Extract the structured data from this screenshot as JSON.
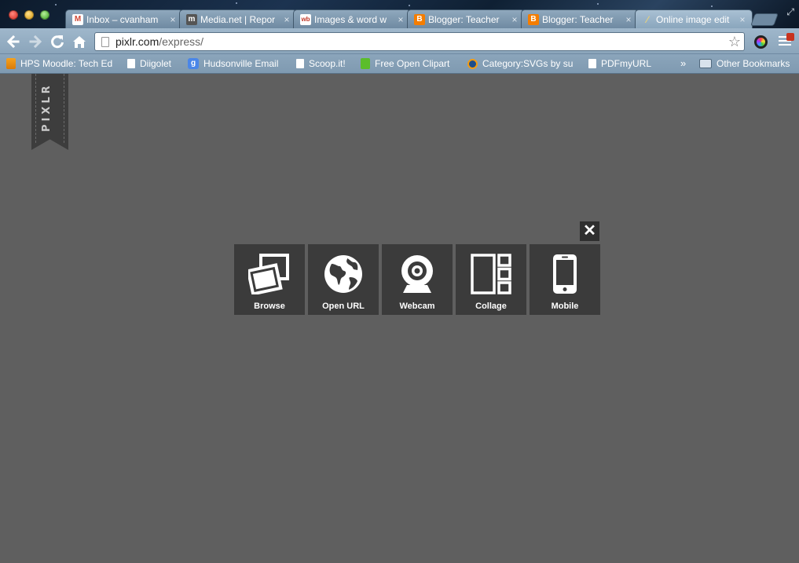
{
  "window": {
    "tabs": [
      {
        "title": "Inbox – cvanham",
        "favicon": "gmail-icon",
        "active": false
      },
      {
        "title": "Media.net | Repor",
        "favicon": "media-net-icon",
        "active": false
      },
      {
        "title": "Images & word w",
        "favicon": "wordle-icon",
        "active": false
      },
      {
        "title": "Blogger: Teacher",
        "favicon": "blogger-icon",
        "active": false
      },
      {
        "title": "Blogger: Teacher",
        "favicon": "blogger-icon",
        "active": false
      },
      {
        "title": "Online image edit",
        "favicon": "pixlr-brush-icon",
        "active": true
      }
    ],
    "tab_close": "×"
  },
  "toolbar": {
    "url_host": "pixlr.com",
    "url_path": "/express/"
  },
  "bookmarks": [
    {
      "label": "HPS Moodle: Tech Ed",
      "icon": "moodle-icon"
    },
    {
      "label": "Diigolet",
      "icon": "page-icon"
    },
    {
      "label": "Hudsonville Email",
      "icon": "google-icon"
    },
    {
      "label": "Scoop.it!",
      "icon": "page-icon"
    },
    {
      "label": "Free Open Clipart",
      "icon": "openclipart-icon"
    },
    {
      "label": "Category:SVGs by su",
      "icon": "wikimedia-icon"
    },
    {
      "label": "PDFmyURL",
      "icon": "page-icon"
    },
    {
      "label": "Other Bookmarks",
      "icon": "folder-icon"
    }
  ],
  "bookmarks_overflow": "»",
  "page": {
    "logo": "PIXLR",
    "close": "✕",
    "tiles": [
      {
        "label": "Browse",
        "icon": "photos-icon"
      },
      {
        "label": "Open URL",
        "icon": "globe-icon"
      },
      {
        "label": "Webcam",
        "icon": "webcam-icon"
      },
      {
        "label": "Collage",
        "icon": "collage-icon"
      },
      {
        "label": "Mobile",
        "icon": "mobile-icon"
      }
    ]
  },
  "colors": {
    "page_background": "#5f5f5f",
    "tile_background": "#3b3b3b",
    "chrome_accent": "#8ba5bb"
  }
}
